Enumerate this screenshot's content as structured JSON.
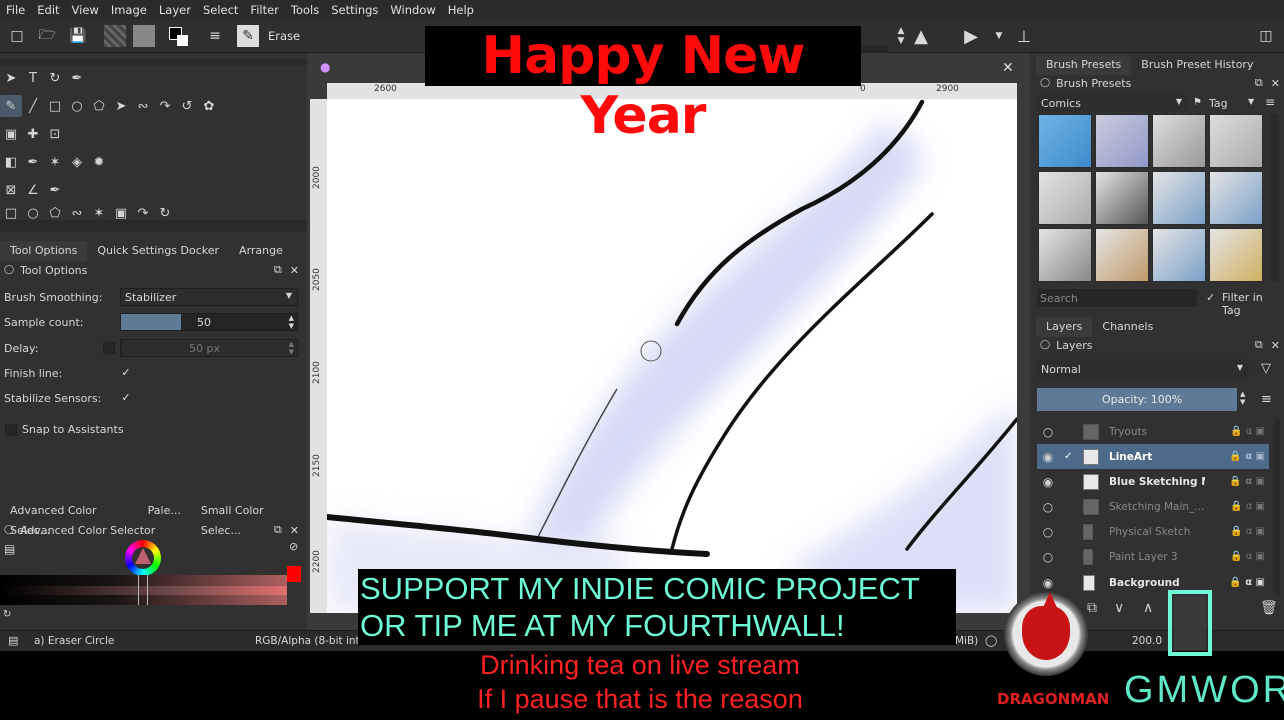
{
  "menu": [
    "File",
    "Edit",
    "View",
    "Image",
    "Layer",
    "Select",
    "Filter",
    "Tools",
    "Settings",
    "Window",
    "Help"
  ],
  "toolbar": {
    "erase_label": "Erase"
  },
  "overlay": {
    "title": "Happy New Year",
    "support_line1": "SUPPORT MY INDIE COMIC PROJECT",
    "support_line2": "OR TIP ME AT MY FOURTHWALL!",
    "stream_line1": "Drinking tea on live stream",
    "stream_line2": "If I pause that is the reason",
    "logo_left_text": "DRAGONMAN",
    "logo_right_text": "GMWOR"
  },
  "rulers": {
    "h_ticks": [
      "2600",
      "0",
      "2900"
    ],
    "v_ticks": [
      "2000",
      "2050",
      "2100",
      "2150",
      "2200"
    ]
  },
  "left_tabs": [
    "Tool Options",
    "Quick Settings Docker",
    "Arrange"
  ],
  "tool_options": {
    "header": "Tool Options",
    "brush_smoothing_label": "Brush Smoothing:",
    "brush_smoothing_value": "Stabilizer",
    "sample_count_label": "Sample count:",
    "sample_count_value": "50",
    "delay_label": "Delay:",
    "delay_value": "50 px",
    "finish_line_label": "Finish line:",
    "stabilize_sensors_label": "Stabilize Sensors:",
    "snap_label": "Snap to Assistants"
  },
  "color_tabs": [
    "Advanced Color Selec...",
    "Pale...",
    "Small Color Selec..."
  ],
  "color_header": "Advanced Color Selector",
  "brush_tabs": [
    "Brush Presets",
    "Brush Preset History"
  ],
  "brush_presets": {
    "header": "Brush Presets",
    "tag_value": "Comics",
    "tag_button": "Tag",
    "search_placeholder": "Search",
    "filter_in_tag": "Filter in Tag"
  },
  "layers_tabs": [
    "Layers",
    "Channels"
  ],
  "layers": {
    "header": "Layers",
    "blend_mode": "Normal",
    "opacity": "Opacity:  100%",
    "items": [
      {
        "name": "Tryouts"
      },
      {
        "name": "LineArt"
      },
      {
        "name": "Blue Sketching M..."
      },
      {
        "name": "Sketching Main_..."
      },
      {
        "name": "Physical Sketch"
      },
      {
        "name": "Paint Layer 3"
      },
      {
        "name": "Background"
      }
    ]
  },
  "status": {
    "brush": "a) Eraser Circle",
    "colorspace": "RGB/Alpha (8-bit inte",
    "memory": "MiB)",
    "zoom": "200.0"
  },
  "colors": {
    "accent": "#5f7a96",
    "overlay_red": "#ff0a0a",
    "overlay_cyan": "#6dfbd8"
  }
}
